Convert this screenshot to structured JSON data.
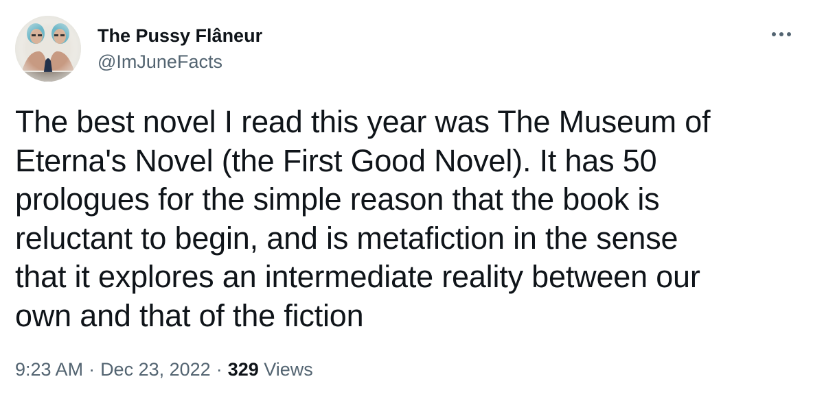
{
  "author": {
    "display_name": "The Pussy Flâneur",
    "handle": "@ImJuneFacts"
  },
  "tweet": {
    "text": "The best novel I read this year was The Museum of\nEterna's Novel (the First Good Novel). It has 50\nprologues for the simple reason that the book is\nreluctant to begin, and is metafiction in the sense\nthat it explores an intermediate reality between our\nown and that of the fiction",
    "time": "9:23 AM",
    "date": "Dec 23, 2022",
    "separator": "·",
    "views_count": "329",
    "views_label": "Views"
  },
  "icons": {
    "more": "more-options-icon",
    "avatar": "profile-avatar"
  },
  "colors": {
    "text_primary": "#0f1419",
    "text_secondary": "#536471",
    "background": "#ffffff"
  }
}
